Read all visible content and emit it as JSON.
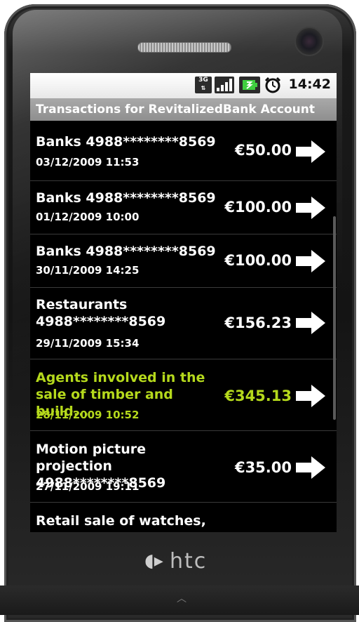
{
  "device": {
    "brand": "htc"
  },
  "status_bar": {
    "network_label": "3G",
    "time": "14:42",
    "icons": [
      "3g-icon",
      "signal-icon",
      "battery-icon",
      "alarm-icon"
    ]
  },
  "screen": {
    "title": "Transactions for RevitalizedBank Account"
  },
  "colors": {
    "highlight": "#b5d91c",
    "text": "#ffffff",
    "background": "#000000"
  },
  "transactions": [
    {
      "desc": "Banks 4988********8569",
      "date": "03/12/2009 11:53",
      "amount": "€50.00",
      "highlight": false
    },
    {
      "desc": "Banks 4988********8569",
      "date": "01/12/2009 10:00",
      "amount": "€100.00",
      "highlight": false
    },
    {
      "desc": "Banks 4988********8569",
      "date": "30/11/2009 14:25",
      "amount": "€100.00",
      "highlight": false
    },
    {
      "desc": "Restaurants 4988********8569",
      "date": "29/11/2009 15:34",
      "amount": "€156.23",
      "highlight": false
    },
    {
      "desc": "Agents involved in the sale of timber and build...",
      "date": "28/11/2009 10:52",
      "amount": "€345.13",
      "highlight": true
    },
    {
      "desc": "Motion picture projection 4988********8569",
      "date": "27/11/2009 19:11",
      "amount": "€35.00",
      "highlight": false
    },
    {
      "desc": "Retail sale of watches,",
      "date": "",
      "amount": "",
      "highlight": false
    }
  ]
}
